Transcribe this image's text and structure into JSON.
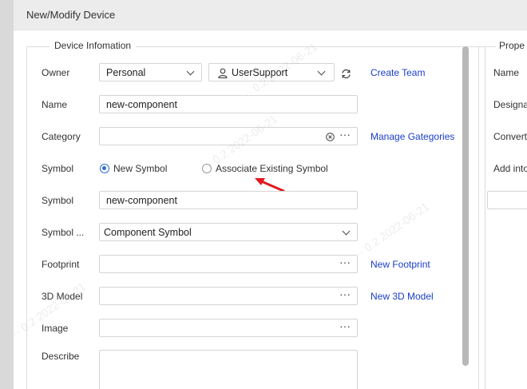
{
  "window": {
    "title": "New/Modify Device"
  },
  "device_info": {
    "group_title": "Device Infomation",
    "owner": {
      "label": "Owner",
      "value": "Personal",
      "team_value": "UserSupport",
      "create_team_link": "Create Team"
    },
    "name": {
      "label": "Name",
      "value": "new-component"
    },
    "category": {
      "label": "Category",
      "value": "",
      "manage_link": "Manage Gategories"
    },
    "symbol_mode": {
      "label": "Symbol",
      "option_new": "New Symbol",
      "option_existing": "Associate Existing Symbol",
      "selected": "New Symbol"
    },
    "symbol": {
      "label": "Symbol",
      "value": "new-component"
    },
    "symbol_type": {
      "label": "Symbol ...",
      "value": "Component Symbol"
    },
    "footprint": {
      "label": "Footprint",
      "value": "",
      "new_link": "New Footprint"
    },
    "model3d": {
      "label": "3D Model",
      "value": "",
      "new_link": "New 3D Model"
    },
    "image": {
      "label": "Image",
      "value": ""
    },
    "describe": {
      "label": "Describe",
      "value": ""
    }
  },
  "properties": {
    "group_title": "Prope",
    "labels": [
      "Name",
      "Designa",
      "Convert",
      "Add into"
    ]
  },
  "colors": {
    "link": "#1a3ec7",
    "radio_selected": "#2f6fd1",
    "annotation_arrow": "#e0191e"
  }
}
